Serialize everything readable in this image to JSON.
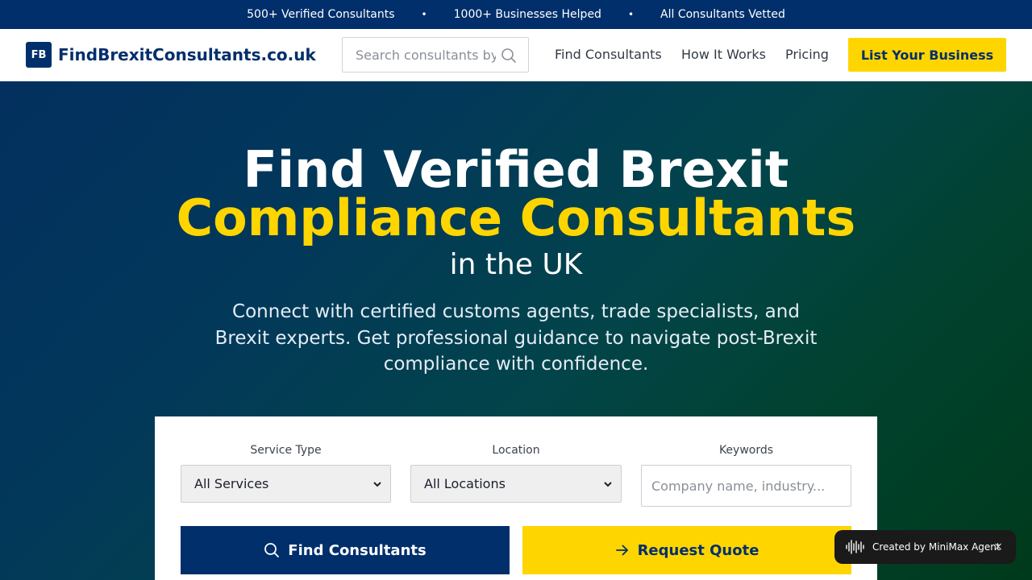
{
  "topbar": {
    "stats": [
      "500+ Verified Consultants",
      "1000+ Businesses Helped",
      "All Consultants Vetted"
    ],
    "separator": "•"
  },
  "header": {
    "logo_badge": "FB",
    "logo_text": "FindBrexitConsultants.co.uk",
    "search_placeholder": "Search consultants by name...",
    "nav": [
      "Find Consultants",
      "How It Works",
      "Pricing"
    ],
    "cta": "List Your Business"
  },
  "hero": {
    "title_line1": "Find Verified Brexit",
    "title_line2": "Compliance Consultants",
    "title_line3": "in the UK",
    "subtitle": "Connect with certified customs agents, trade specialists, and Brexit experts. Get professional guidance to navigate post-Brexit compliance with confidence."
  },
  "search_panel": {
    "service_label": "Service Type",
    "service_value": "All Services",
    "location_label": "Location",
    "location_value": "All Locations",
    "keywords_label": "Keywords",
    "keywords_placeholder": "Company name, industry...",
    "find_button": "Find Consultants",
    "quote_button": "Request Quote"
  },
  "agent_badge": {
    "text": "Created by MiniMax Agent",
    "close": "×"
  },
  "colors": {
    "navy": "#012f6b",
    "yellow": "#ffd500"
  }
}
